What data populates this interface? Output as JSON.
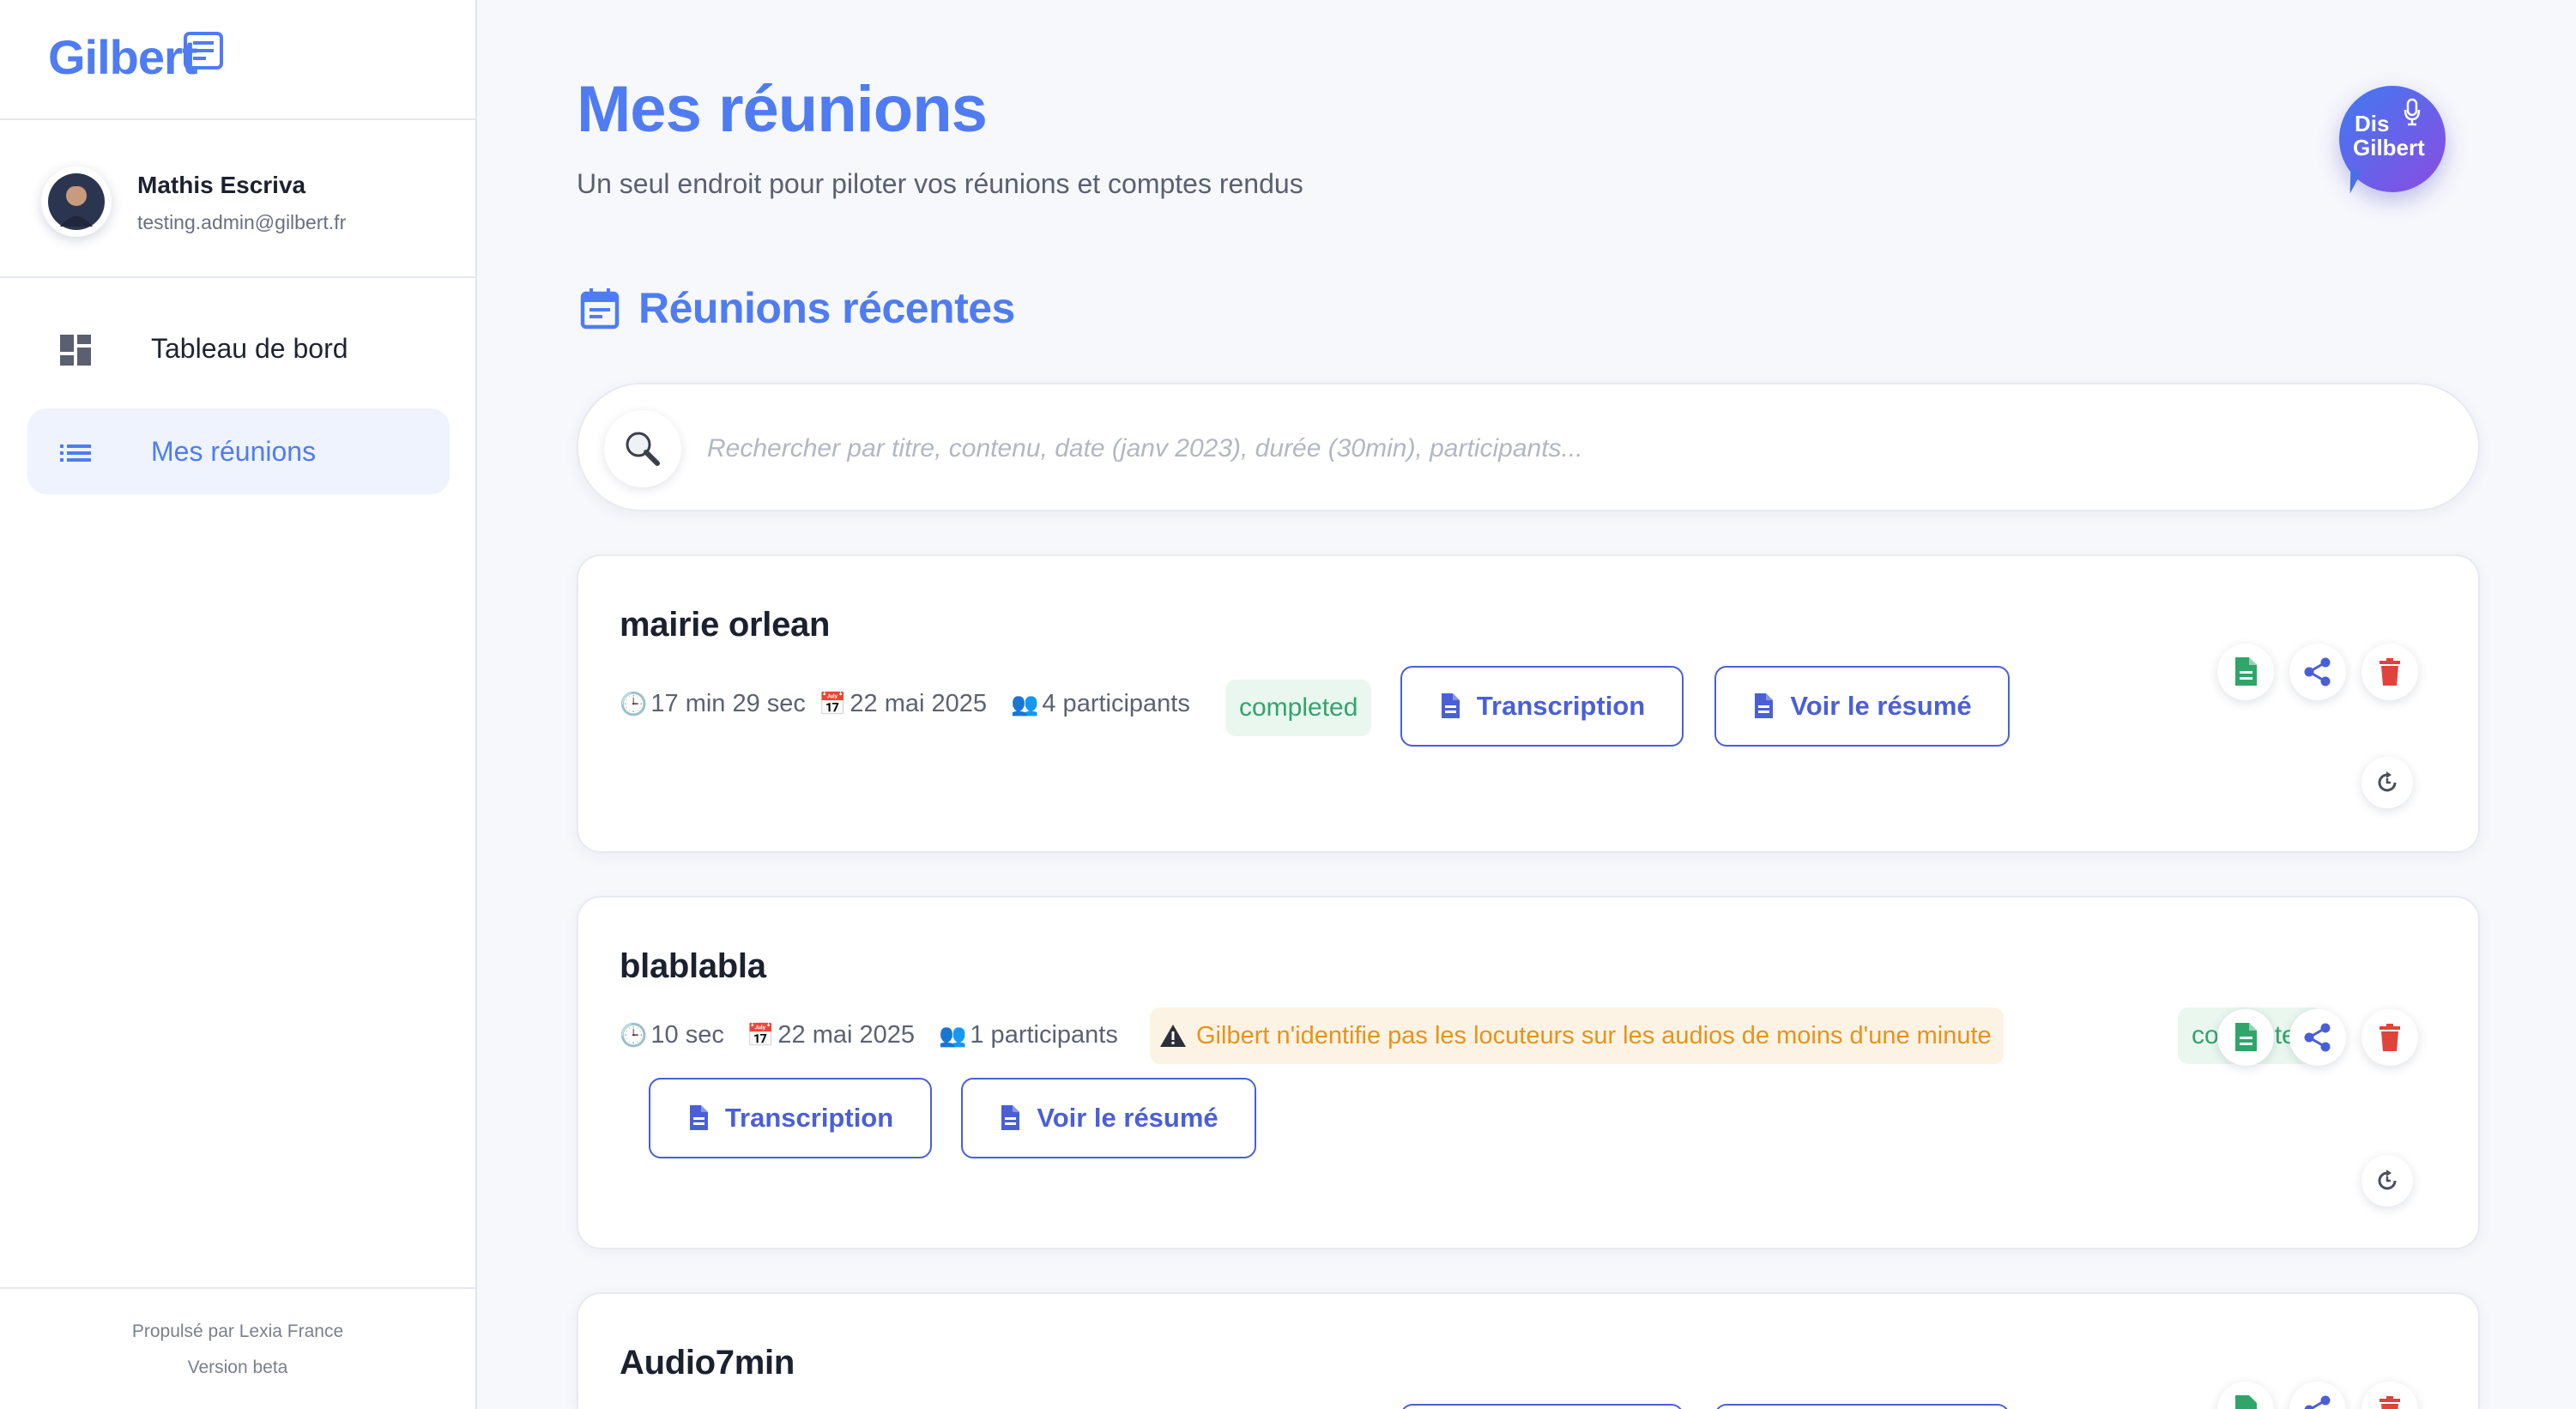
{
  "app": {
    "logo_text": "Gilbert"
  },
  "user": {
    "name": "Mathis Escriva",
    "email": "testing.admin@gilbert.fr"
  },
  "nav": {
    "items": [
      {
        "label": "Tableau de bord",
        "icon": "dashboard-icon",
        "active": false
      },
      {
        "label": "Mes réunions",
        "icon": "list-icon",
        "active": true
      }
    ]
  },
  "footer": {
    "powered_by": "Propulsé par Lexia France",
    "version": "Version beta"
  },
  "header": {
    "title": "Mes réunions",
    "subtitle": "Un seul endroit pour piloter vos réunions et comptes rendus",
    "assistant_line1": "Dis",
    "assistant_line2": "Gilbert"
  },
  "section": {
    "title": "Réunions récentes"
  },
  "search": {
    "placeholder": "Rechercher par titre, contenu, date (janv 2023), durée (30min), participants..."
  },
  "meetings": [
    {
      "title": "mairie orlean",
      "duration": "17 min 29 sec",
      "date": "22 mai 2025",
      "participants": "4 participants",
      "status": "completed",
      "transcription_label": "Transcription",
      "summary_label": "Voir le résumé"
    },
    {
      "title": "blablabla",
      "duration": "10 sec",
      "date": "22 mai 2025",
      "participants": "1 participants",
      "warning": "Gilbert n'identifie pas les locuteurs sur les audios de moins d'une minute",
      "status": "completed",
      "transcription_label": "Transcription",
      "summary_label": "Voir le résumé"
    },
    {
      "title": "Audio7min"
    }
  ],
  "colors": {
    "accent": "#4f7cf2",
    "button": "#4a5fd6",
    "success": "#2fa56a",
    "warning": "#e8921b",
    "danger": "#e0433a"
  }
}
